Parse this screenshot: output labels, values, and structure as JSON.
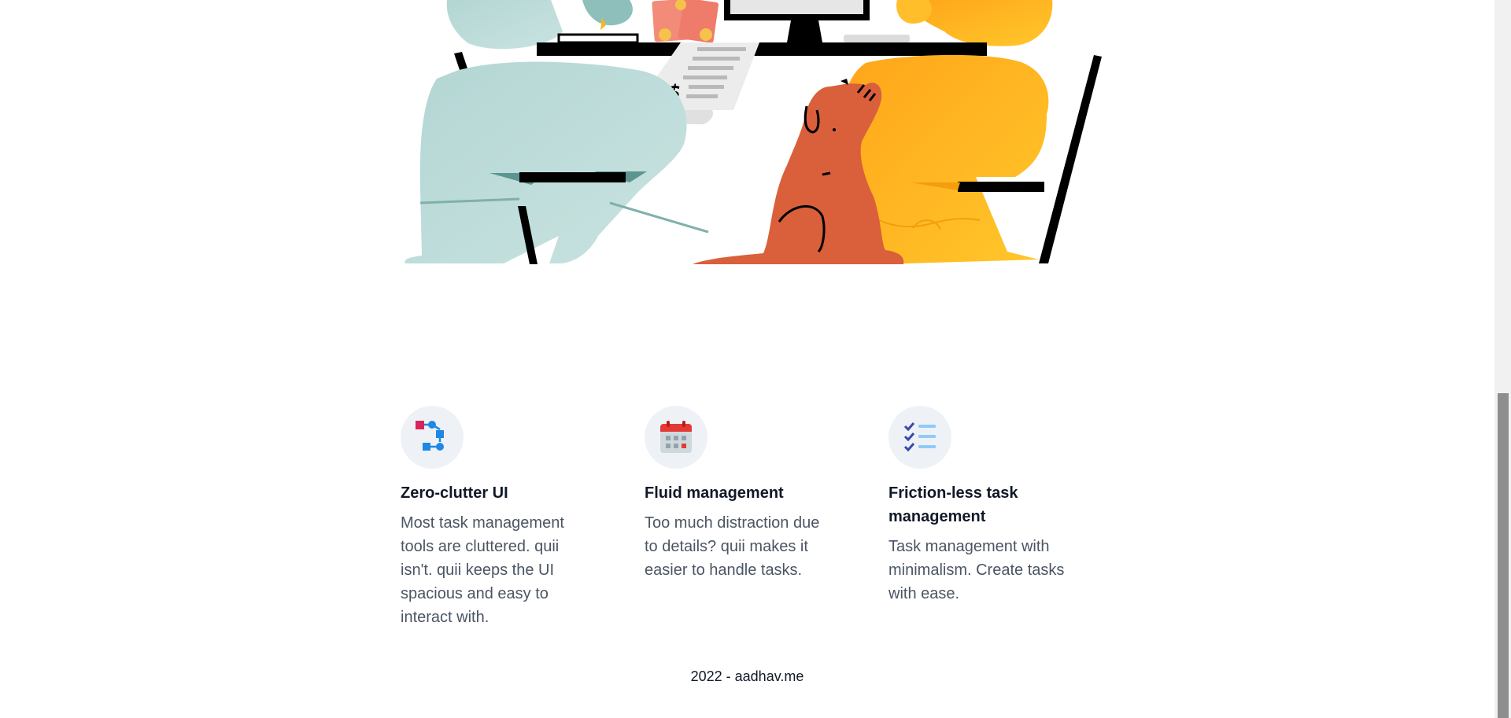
{
  "illustration": {
    "icon": "finance-desk-illustration",
    "receipt_symbol": "$",
    "colors": {
      "person_left": "#b7d8d6",
      "person_right": "#ffb21f",
      "dog": "#d95f3b",
      "desk": "#000000"
    }
  },
  "features": [
    {
      "icon": "flow-nodes-icon",
      "title": "Zero-clutter UI",
      "description": "Most task management tools are cluttered. quii isn't. quii keeps the UI spacious and easy to interact with."
    },
    {
      "icon": "calendar-icon",
      "title": "Fluid management",
      "description": "Too much distraction due to details? quii makes it easier to handle tasks."
    },
    {
      "icon": "checklist-icon",
      "title": "Friction-less task management",
      "description": "Task management with minimalism. Create tasks with ease."
    }
  ],
  "footer": {
    "text": "2022 - aadhav.me"
  },
  "colors": {
    "icon_circle_bg": "#eef2f7",
    "title": "#111827",
    "body_text": "#4b5563"
  }
}
